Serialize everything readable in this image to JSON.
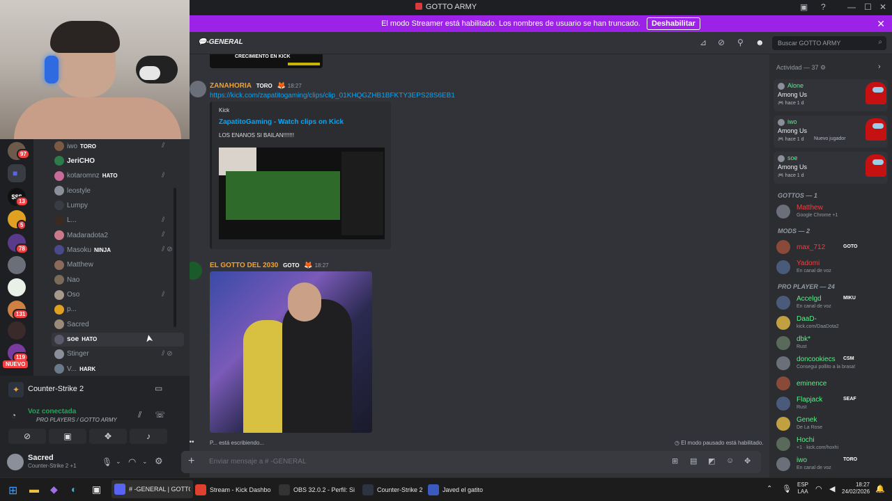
{
  "window": {
    "title": "GOTTO ARMY"
  },
  "banner": {
    "text": "El modo Streamer está habilitado. Los nombres de usuario se han truncado.",
    "button": "Deshabilitar"
  },
  "channel": {
    "name": "-GENERAL",
    "search_placeholder": "Buscar GOTTO ARMY"
  },
  "rail": {
    "badges": [
      "97",
      "13",
      "5",
      "78",
      "131",
      "119"
    ],
    "nuevo": "NUEVO",
    "dollar": "$$$"
  },
  "voice_members": [
    {
      "name": "iwo",
      "tag": "TORO"
    },
    {
      "name": "JeriCHO",
      "tag": ""
    },
    {
      "name": "kotaromnz",
      "tag": "HATO"
    },
    {
      "name": "leostyle",
      "tag": ""
    },
    {
      "name": "Lumpy",
      "tag": ""
    },
    {
      "name": "L...",
      "tag": ""
    },
    {
      "name": "Madaradota2",
      "tag": ""
    },
    {
      "name": "Masoku",
      "tag": "NINJA"
    },
    {
      "name": "Matthew",
      "tag": ""
    },
    {
      "name": "Nao",
      "tag": ""
    },
    {
      "name": "Oso",
      "tag": ""
    },
    {
      "name": "p...",
      "tag": ""
    },
    {
      "name": "Sacred",
      "tag": ""
    },
    {
      "name": "soe",
      "tag": "HATO"
    },
    {
      "name": "Stinger",
      "tag": ""
    },
    {
      "name": "V...",
      "tag": "HARK"
    }
  ],
  "game": {
    "name": "Counter-Strike 2"
  },
  "voice": {
    "status": "Voz conectada",
    "location": "PRO PLAYERS / GOTTO ARMY"
  },
  "user": {
    "name": "Sacred",
    "activity": "Counter-Strike 2 +1"
  },
  "chat": {
    "prev_image_text": "CRECIMIENTO EN KICK",
    "msg1": {
      "author": "ZANAHORIA",
      "tag": "TORO",
      "time": "18:27",
      "link": "https://kick.com/zapatitogaming/clips/clip_01KHQGZHB1BFKTY3EPS28S6EB1",
      "embed_provider": "Kick",
      "embed_title": "ZapatitoGaming - Watch clips on Kick",
      "embed_desc": "LOS ENANOS SI BAILAN!!!!!!!"
    },
    "msg2": {
      "author": "EL GOTTO DEL 2030",
      "tag": "GOTO",
      "time": "18:27"
    },
    "typing": "P... está escribiendo...",
    "slowmode": "El modo pausado está habilitado."
  },
  "composer": {
    "placeholder": "Enviar mensaje a #  -GENERAL"
  },
  "activity": {
    "header": "Actividad — 37",
    "cards": [
      {
        "user": "Alone",
        "game": "Among Us",
        "time": "hace 1 d",
        "extra": ""
      },
      {
        "user": "iwo",
        "game": "Among Us",
        "time": "hace 1 d",
        "extra": "Nuevo jugador"
      },
      {
        "user": "soe",
        "game": "Among Us",
        "time": "hace 1 d",
        "extra": ""
      }
    ],
    "groups": [
      {
        "title": "GOTTOS — 1",
        "members": [
          {
            "name": "Matthew",
            "sub": "Google Chrome +1",
            "color": "#f23f42",
            "tag": ""
          }
        ]
      },
      {
        "title": "MODS — 2",
        "members": [
          {
            "name": "max_712",
            "sub": "",
            "color": "#f23f42",
            "tag": "GOTO"
          },
          {
            "name": "Yadomi",
            "sub": "En canal de voz",
            "color": "#f23f42",
            "tag": ""
          }
        ]
      },
      {
        "title": "PRO PLAYER — 24",
        "members": [
          {
            "name": "Accelgd",
            "sub": "En canal de voz",
            "color": "#57f287",
            "tag": "MIKU"
          },
          {
            "name": "DaaD-",
            "sub": "kick.com/DaaDota2",
            "color": "#57f287",
            "tag": ""
          },
          {
            "name": "dbk*",
            "sub": "Rust",
            "color": "#57f287",
            "tag": ""
          },
          {
            "name": "doncookiecs",
            "sub": "Consegui pollito a la brasa!",
            "color": "#57f287",
            "tag": "CSM"
          },
          {
            "name": "eminence",
            "sub": "",
            "color": "#57f287",
            "tag": ""
          },
          {
            "name": "Flapjack",
            "sub": "Rust",
            "color": "#57f287",
            "tag": "SEAF"
          },
          {
            "name": "Genek",
            "sub": "De La Rose",
            "color": "#57f287",
            "tag": ""
          },
          {
            "name": "Hochi",
            "sub": "+1 · kick.com/hoxhi",
            "color": "#57f287",
            "tag": ""
          },
          {
            "name": "iwo",
            "sub": "En canal de voz",
            "color": "#57f287",
            "tag": "TORO"
          }
        ]
      }
    ]
  },
  "taskbar": {
    "items": [
      "#  -GENERAL | GOTTO",
      "Stream - Kick Dashboard",
      "OBS 32.0.2 - Perfil: Sin T",
      "Counter-Strike 2",
      "Javed el gatito"
    ],
    "lang": "ESP",
    "lang2": "LAA",
    "time": "18:27",
    "date": "24/02/2026"
  },
  "colors": {
    "accent": "#9b22e6",
    "link": "#00a8fc",
    "orange": "#f0a232",
    "green": "#23a55a",
    "red": "#f23f42"
  }
}
